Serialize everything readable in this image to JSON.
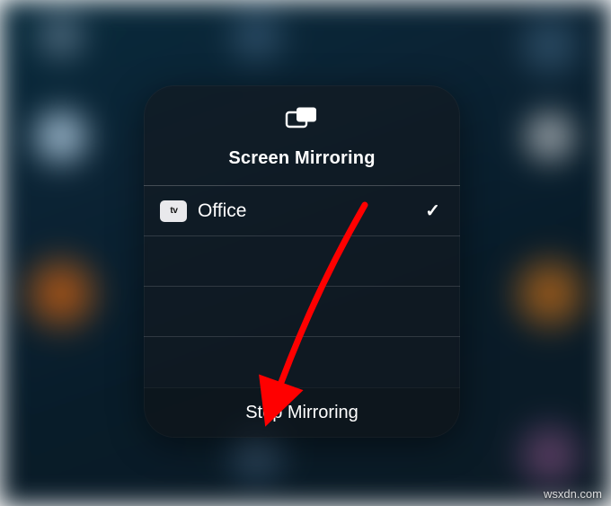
{
  "panel": {
    "title": "Screen Mirroring",
    "stop_label": "Stop Mirroring"
  },
  "devices": [
    {
      "badge_prefix": "",
      "badge_text": "tv",
      "name": "Office",
      "selected": true
    }
  ],
  "watermark": "wsxdn.com"
}
